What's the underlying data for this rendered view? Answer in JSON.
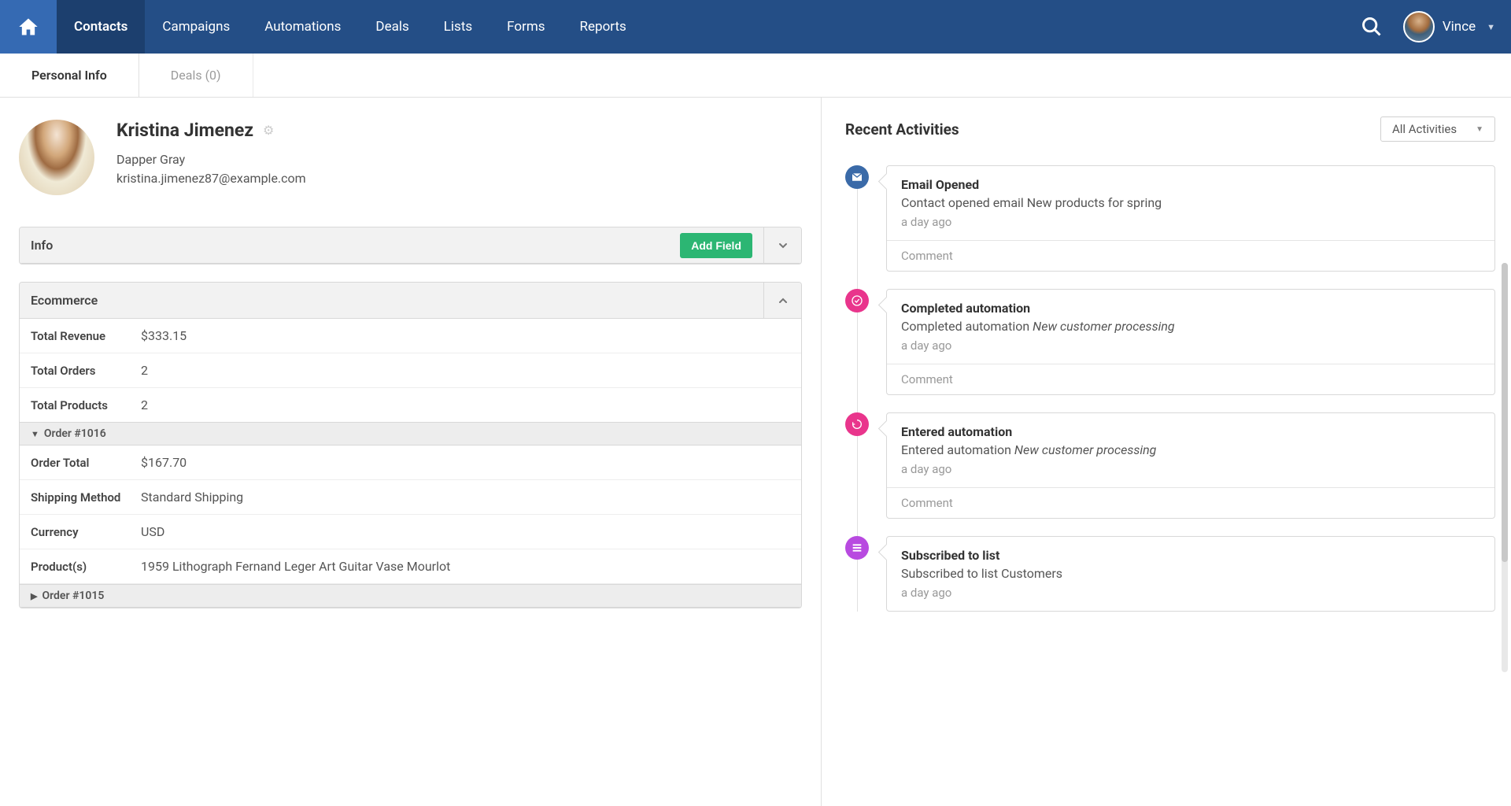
{
  "nav": {
    "items": [
      "Contacts",
      "Campaigns",
      "Automations",
      "Deals",
      "Lists",
      "Forms",
      "Reports"
    ],
    "active_index": 0,
    "user_name": "Vince"
  },
  "tabs": {
    "items": [
      {
        "label": "Personal Info"
      },
      {
        "label": "Deals (0)"
      }
    ],
    "active_index": 0
  },
  "contact": {
    "name": "Kristina Jimenez",
    "company": "Dapper Gray",
    "email": "kristina.jimenez87@example.com"
  },
  "panels": {
    "info": {
      "title": "Info",
      "add_field": "Add Field"
    },
    "ecommerce": {
      "title": "Ecommerce",
      "summary": [
        {
          "label": "Total Revenue",
          "value": "$333.15"
        },
        {
          "label": "Total Orders",
          "value": "2"
        },
        {
          "label": "Total Products",
          "value": "2"
        }
      ],
      "orders": [
        {
          "header": "Order #1016",
          "expanded": true,
          "rows": [
            {
              "label": "Order Total",
              "value": "$167.70"
            },
            {
              "label": "Shipping Method",
              "value": "Standard Shipping"
            },
            {
              "label": "Currency",
              "value": "USD"
            },
            {
              "label": "Product(s)",
              "value": "1959 Lithograph Fernand Leger Art Guitar Vase Mourlot"
            }
          ]
        },
        {
          "header": "Order #1015",
          "expanded": false,
          "rows": []
        }
      ]
    }
  },
  "recent": {
    "title": "Recent Activities",
    "filter": "All Activities",
    "comment_label": "Comment",
    "activities": [
      {
        "icon": "email",
        "color": "ic-blue",
        "title": "Email Opened",
        "desc": "Contact opened email New products for spring",
        "desc_em": "",
        "time": "a day ago"
      },
      {
        "icon": "automation-done",
        "color": "ic-pink",
        "title": "Completed automation",
        "desc": "Completed automation ",
        "desc_em": "New customer processing",
        "time": "a day ago"
      },
      {
        "icon": "automation-enter",
        "color": "ic-pink",
        "title": "Entered automation",
        "desc": "Entered automation ",
        "desc_em": "New customer processing",
        "time": "a day ago"
      },
      {
        "icon": "list",
        "color": "ic-purple",
        "title": "Subscribed to list",
        "desc": "Subscribed to list Customers",
        "desc_em": "",
        "time": "a day ago"
      }
    ]
  }
}
